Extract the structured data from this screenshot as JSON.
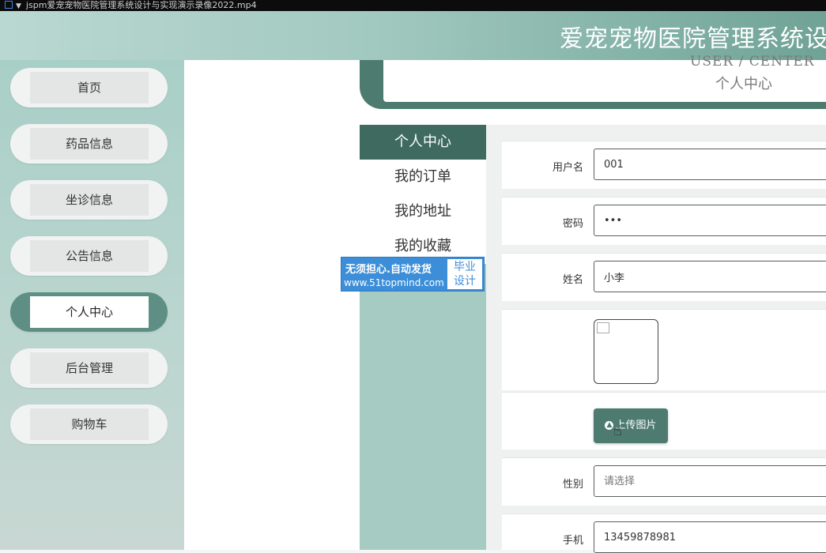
{
  "window": {
    "title": "jspm爱宠宠物医院管理系统设计与实现演示录像2022.mp4"
  },
  "header": {
    "site_title": "爱宠宠物医院管理系统设计"
  },
  "sidebar": {
    "items": [
      {
        "label": "首页"
      },
      {
        "label": "药品信息"
      },
      {
        "label": "坐诊信息"
      },
      {
        "label": "公告信息"
      },
      {
        "label": "个人中心",
        "active": true
      },
      {
        "label": "后台管理"
      },
      {
        "label": "购物车"
      }
    ]
  },
  "banner": {
    "title_en": "USER / CENTER",
    "title_cn": "个人中心"
  },
  "submenu": {
    "items": [
      {
        "label": "个人中心",
        "active": true
      },
      {
        "label": "我的订单"
      },
      {
        "label": "我的地址"
      },
      {
        "label": "我的收藏"
      }
    ]
  },
  "watermark": {
    "line1": "无须担心.自动发货",
    "line2": "www.51topmind.com",
    "box_line1": "毕业",
    "box_line2": "设计"
  },
  "form": {
    "username": {
      "label": "用户名",
      "value": "001"
    },
    "password": {
      "label": "密码",
      "value": "•••"
    },
    "name": {
      "label": "姓名",
      "value": "小李"
    },
    "upload_label": "上传图片",
    "gender": {
      "label": "性别",
      "placeholder": "请选择"
    },
    "phone": {
      "label": "手机",
      "value": "13459878981"
    }
  },
  "colors": {
    "accent": "#4d7b70",
    "active_tab": "#3e6a60",
    "sidebar_bg": "#a8cfc7",
    "watermark": "#3c8ed8"
  }
}
